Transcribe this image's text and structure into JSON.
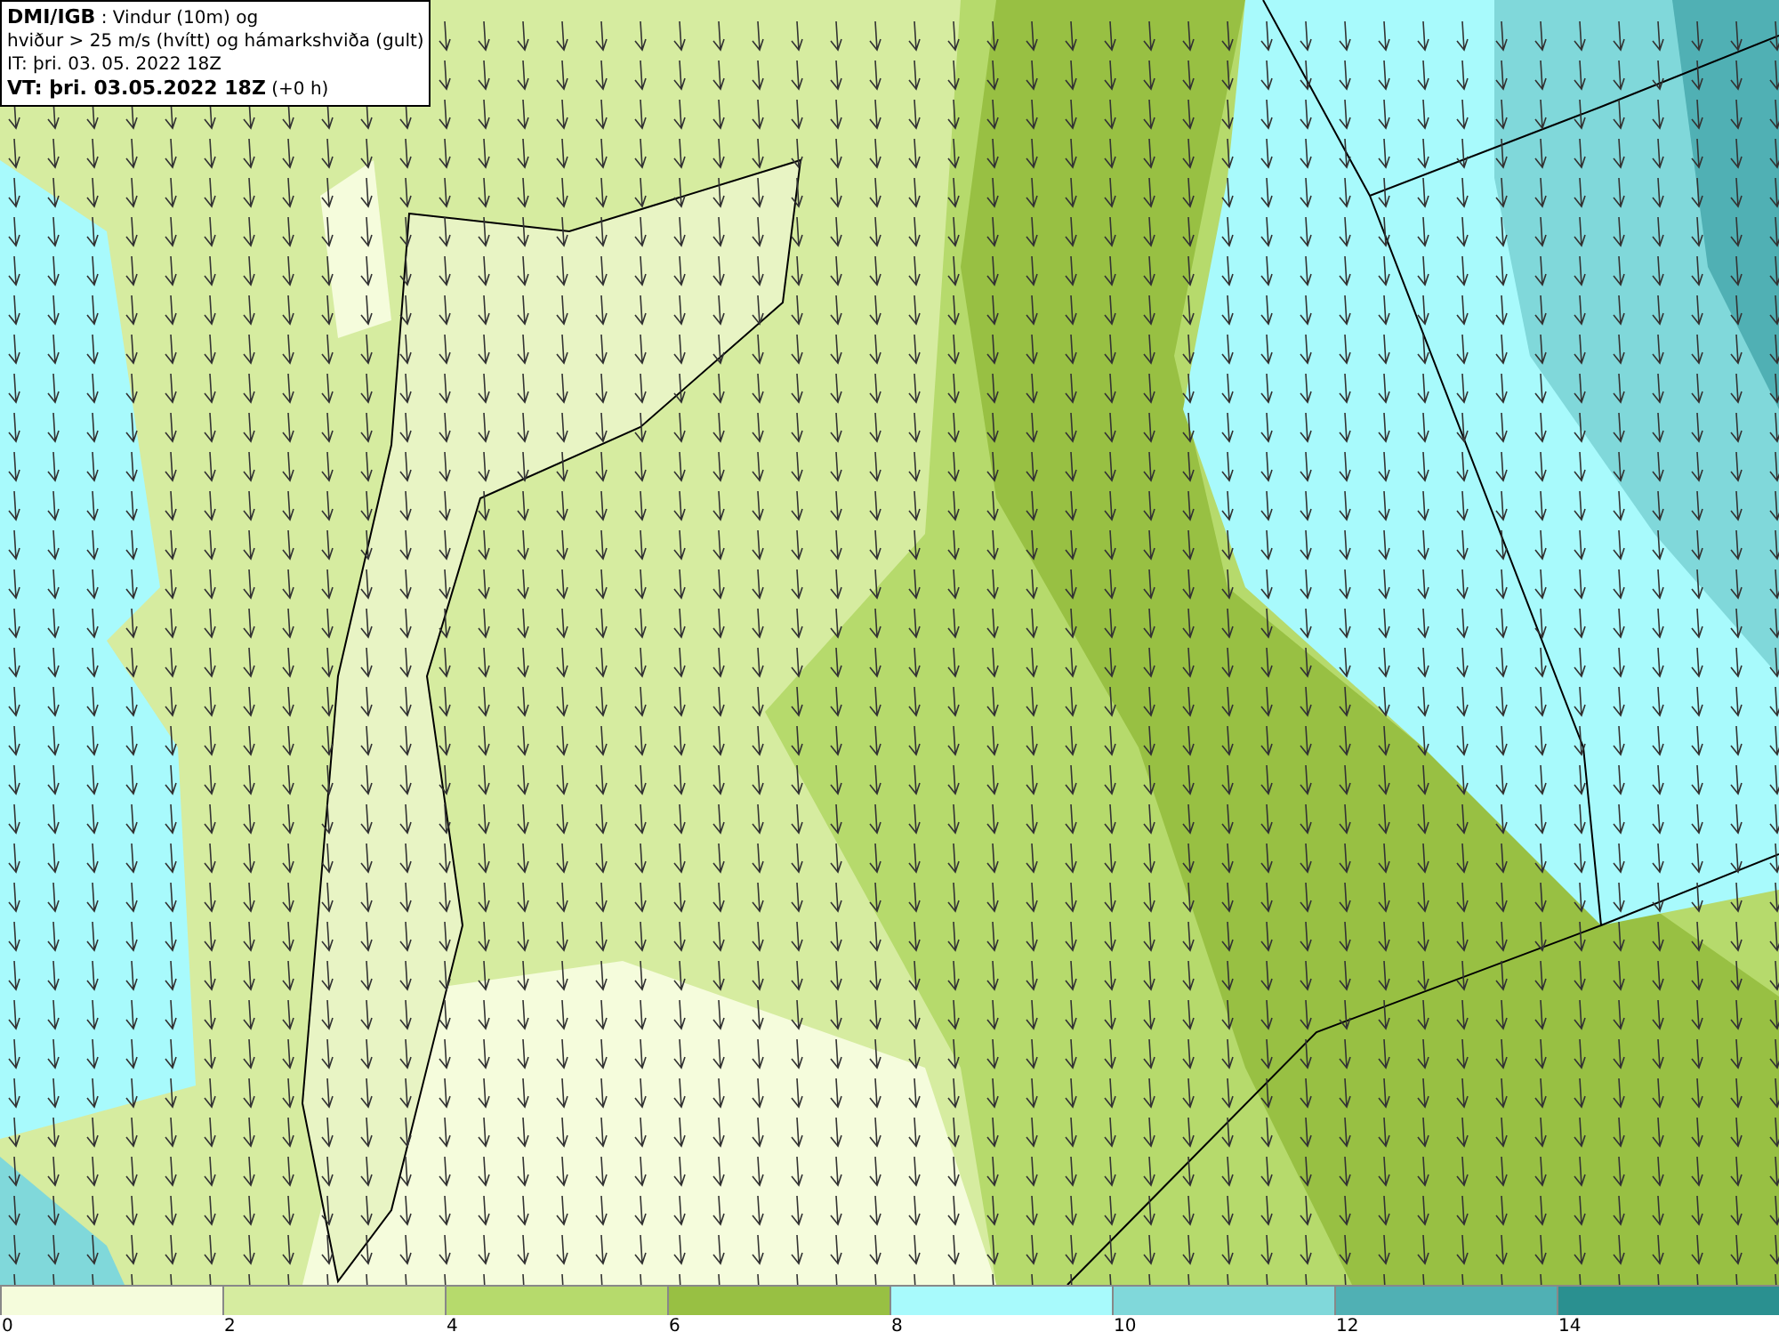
{
  "title_box": {
    "lines": [
      "**DMI/IGB** : Vindur (10m) og",
      "hviður > 25 m/s (hvítt) og hámarkshviða (gult)",
      "IT: þri. 03. 05. 2022 18Z",
      "**VT: þri. 03.05.2022 18Z** (+0 h)"
    ]
  },
  "legend": {
    "swatches": [
      {
        "color": "#f5fcdc"
      },
      {
        "color": "#d6eca0"
      },
      {
        "color": "#b6da6c"
      },
      {
        "color": "#98c043"
      },
      {
        "color": "#a8fafc"
      },
      {
        "color": "#80d8da"
      },
      {
        "color": "#50b0b4"
      },
      {
        "color": "#2a9090"
      }
    ],
    "ticks": [
      "0",
      "2",
      "4",
      "6",
      "8",
      "10",
      "12",
      "14"
    ]
  }
}
